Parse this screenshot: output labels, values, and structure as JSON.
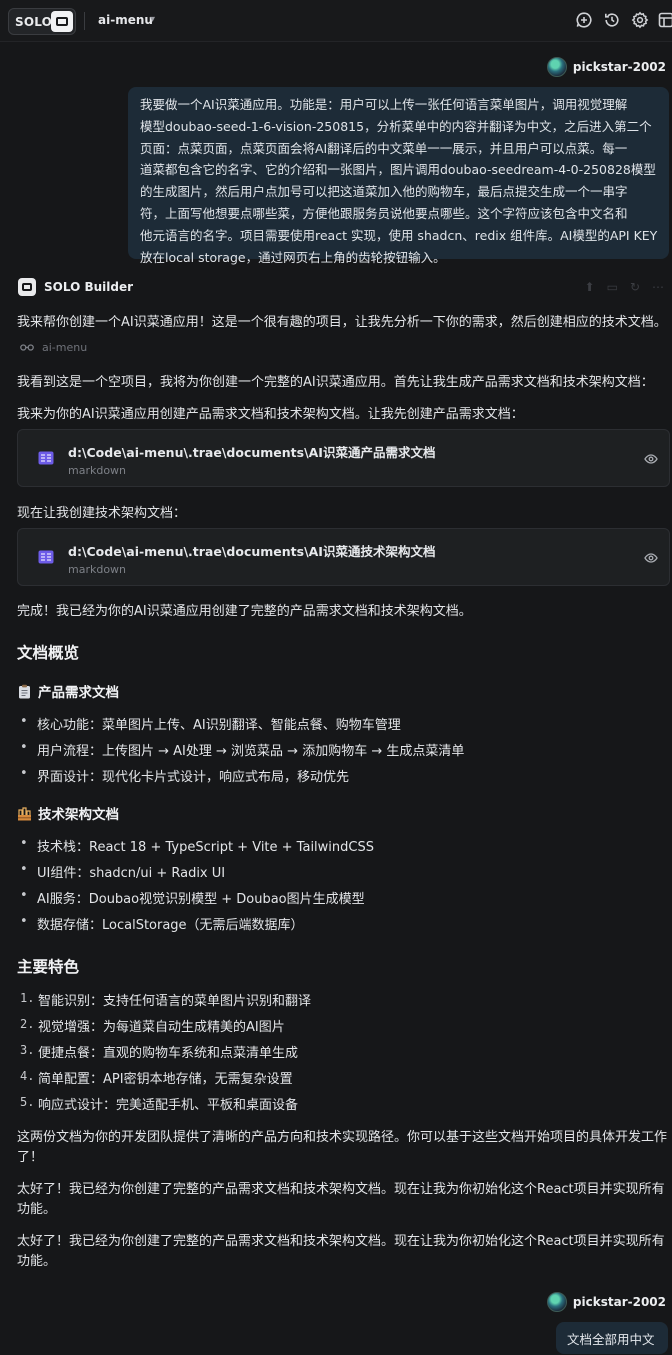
{
  "header": {
    "solo_label": "SOLO",
    "project": "ai-menu",
    "icons": [
      "new-chat-icon",
      "history-icon",
      "settings-icon",
      "grid-icon"
    ]
  },
  "user": {
    "name": "pickstar-2002"
  },
  "user_message": {
    "lines": [
      "我要做一个AI识菜通应用。功能是：用户可以上传一张任何语言菜单图片，调用视觉理解",
      "模型doubao-seed-1-6-vision-250815，分析菜单中的内容并翻译为中文，之后进入第二个",
      "页面：点菜页面，点菜页面会将AI翻译后的中文菜单一一展示，并且用户可以点菜。每一",
      "道菜都包含它的名字、它的介绍和一张图片，图片调用doubao-seedream-4-0-250828模型",
      "的生成图片，然后用户点加号可以把这道菜加入他的购物车，最后点提交生成一个一串字",
      "符，上面写他想要点哪些菜，方便他跟服务员说他要点哪些。这个字符应该包含中文名和",
      "他元语言的名字。项目需要使用react 实现，使用 shadcn、redix 组件库。AI模型的API KEY",
      "放在local storage，通过网页右上角的齿轮按钮输入。"
    ]
  },
  "assistant": {
    "name": "SOLO Builder",
    "intro": "我来帮你创建一个AI识菜通应用！这是一个很有趣的项目，让我先分析一下你的需求，然后创建相应的技术文档。",
    "tool_ref": "ai-menu",
    "p1": "我看到这是一个空项目，我将为你创建一个完整的AI识菜通应用。首先让我生成产品需求文档和技术架构文档：",
    "p2": "我来为你的AI识菜通应用创建产品需求文档和技术架构文档。让我先创建产品需求文档：",
    "doc1": {
      "path": "d:\\Code\\ai-menu\\.trae\\documents\\AI识菜通产品需求文档",
      "type": "markdown"
    },
    "p3": "现在让我创建技术架构文档：",
    "doc2": {
      "path": "d:\\Code\\ai-menu\\.trae\\documents\\AI识菜通技术架构文档",
      "type": "markdown"
    },
    "done": "完成！我已经为你的AI识菜通应用创建了完整的产品需求文档和技术架构文档。",
    "overview_title": "文档概览",
    "prd_title": "产品需求文档",
    "prd_items": [
      "核心功能：菜单图片上传、AI识别翻译、智能点餐、购物车管理",
      "用户流程：上传图片 → AI处理 → 浏览菜品 → 添加购物车 → 生成点菜清单",
      "界面设计：现代化卡片式设计，响应式布局，移动优先"
    ],
    "tech_title": "技术架构文档",
    "tech_items": [
      "技术栈：React 18 + TypeScript + Vite + TailwindCSS",
      "UI组件：shadcn/ui + Radix UI",
      "AI服务：Doubao视觉识别模型 + Doubao图片生成模型",
      "数据存储：LocalStorage（无需后端数据库）"
    ],
    "features_title": "主要特色",
    "features": [
      {
        "num": "1.",
        "text": "智能识别：支持任何语言的菜单图片识别和翻译"
      },
      {
        "num": "2.",
        "text": "视觉增强：为每道菜自动生成精美的AI图片"
      },
      {
        "num": "3.",
        "text": "便捷点餐：直观的购物车系统和点菜清单生成"
      },
      {
        "num": "4.",
        "text": "简单配置：API密钥本地存储，无需复杂设置"
      },
      {
        "num": "5.",
        "text": "响应式设计：完美适配手机、平板和桌面设备"
      }
    ],
    "closing": [
      "这两份文档为你的开发团队提供了清晰的产品方向和技术实现路径。你可以基于这些文档开始项目的具体开发工作",
      "了！"
    ],
    "followup1": [
      "太好了！我已经为你创建了完整的产品需求文档和技术架构文档。现在让我为你初始化这个React项目并实现所有",
      "功能。"
    ],
    "followup2": [
      "太好了！我已经为你创建了完整的产品需求文档和技术架构文档。现在让我为你初始化这个React项目并实现所有",
      "功能。"
    ]
  },
  "final_user_message": "文档全部用中文"
}
